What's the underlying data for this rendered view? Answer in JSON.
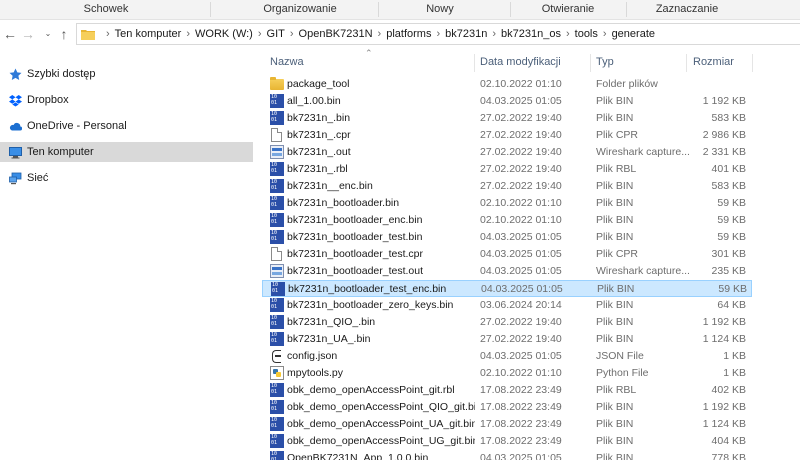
{
  "ribbon": {
    "groups": [
      "Schowek",
      "Organizowanie",
      "Nowy",
      "Otwieranie",
      "Zaznaczanie"
    ]
  },
  "nav": {
    "back_icon": "arrow-left-icon",
    "forward_icon": "arrow-right-icon",
    "dropdown_icon": "chevron-down-icon",
    "up_icon": "arrow-up-icon"
  },
  "address": {
    "crumbs": [
      "Ten komputer",
      "WORK (W:)",
      "GIT",
      "OpenBK7231N",
      "platforms",
      "bk7231n",
      "bk7231n_os",
      "tools",
      "generate"
    ]
  },
  "sidebar": {
    "items": [
      {
        "label": "Szybki dostęp",
        "icon": "star-icon"
      },
      {
        "label": "Dropbox",
        "icon": "dropbox-icon"
      },
      {
        "label": "OneDrive - Personal",
        "icon": "cloud-icon"
      },
      {
        "label": "Ten komputer",
        "icon": "computer-icon",
        "selected": true
      },
      {
        "label": "Sieć",
        "icon": "network-icon"
      }
    ]
  },
  "columns": {
    "name": "Nazwa",
    "date": "Data modyfikacji",
    "type": "Typ",
    "size": "Rozmiar"
  },
  "files": [
    {
      "name": "package_tool",
      "date": "02.10.2022 01:10",
      "type": "Folder plików",
      "size": "",
      "icon": "folder"
    },
    {
      "name": "all_1.00.bin",
      "date": "04.03.2025 01:05",
      "type": "Plik BIN",
      "size": "1 192 KB",
      "icon": "bin"
    },
    {
      "name": "bk7231n_.bin",
      "date": "27.02.2022 19:40",
      "type": "Plik BIN",
      "size": "583 KB",
      "icon": "bin"
    },
    {
      "name": "bk7231n_.cpr",
      "date": "27.02.2022 19:40",
      "type": "Plik CPR",
      "size": "2 986 KB",
      "icon": "doc"
    },
    {
      "name": "bk7231n_.out",
      "date": "27.02.2022 19:40",
      "type": "Wireshark capture...",
      "size": "2 331 KB",
      "icon": "ws"
    },
    {
      "name": "bk7231n_.rbl",
      "date": "27.02.2022 19:40",
      "type": "Plik RBL",
      "size": "401 KB",
      "icon": "bin"
    },
    {
      "name": "bk7231n__enc.bin",
      "date": "27.02.2022 19:40",
      "type": "Plik BIN",
      "size": "583 KB",
      "icon": "bin"
    },
    {
      "name": "bk7231n_bootloader.bin",
      "date": "02.10.2022 01:10",
      "type": "Plik BIN",
      "size": "59 KB",
      "icon": "bin"
    },
    {
      "name": "bk7231n_bootloader_enc.bin",
      "date": "02.10.2022 01:10",
      "type": "Plik BIN",
      "size": "59 KB",
      "icon": "bin"
    },
    {
      "name": "bk7231n_bootloader_test.bin",
      "date": "04.03.2025 01:05",
      "type": "Plik BIN",
      "size": "59 KB",
      "icon": "bin"
    },
    {
      "name": "bk7231n_bootloader_test.cpr",
      "date": "04.03.2025 01:05",
      "type": "Plik CPR",
      "size": "301 KB",
      "icon": "doc"
    },
    {
      "name": "bk7231n_bootloader_test.out",
      "date": "04.03.2025 01:05",
      "type": "Wireshark capture...",
      "size": "235 KB",
      "icon": "ws"
    },
    {
      "name": "bk7231n_bootloader_test_enc.bin",
      "date": "04.03.2025 01:05",
      "type": "Plik BIN",
      "size": "59 KB",
      "icon": "bin",
      "selected": true
    },
    {
      "name": "bk7231n_bootloader_zero_keys.bin",
      "date": "03.06.2024 20:14",
      "type": "Plik BIN",
      "size": "64 KB",
      "icon": "bin"
    },
    {
      "name": "bk7231n_QIO_.bin",
      "date": "27.02.2022 19:40",
      "type": "Plik BIN",
      "size": "1 192 KB",
      "icon": "bin"
    },
    {
      "name": "bk7231n_UA_.bin",
      "date": "27.02.2022 19:40",
      "type": "Plik BIN",
      "size": "1 124 KB",
      "icon": "bin"
    },
    {
      "name": "config.json",
      "date": "04.03.2025 01:05",
      "type": "JSON File",
      "size": "1 KB",
      "icon": "json"
    },
    {
      "name": "mpytools.py",
      "date": "02.10.2022 01:10",
      "type": "Python File",
      "size": "1 KB",
      "icon": "py"
    },
    {
      "name": "obk_demo_openAccessPoint_git.rbl",
      "date": "17.08.2022 23:49",
      "type": "Plik RBL",
      "size": "402 KB",
      "icon": "bin"
    },
    {
      "name": "obk_demo_openAccessPoint_QIO_git.bin",
      "date": "17.08.2022 23:49",
      "type": "Plik BIN",
      "size": "1 192 KB",
      "icon": "bin"
    },
    {
      "name": "obk_demo_openAccessPoint_UA_git.bin",
      "date": "17.08.2022 23:49",
      "type": "Plik BIN",
      "size": "1 124 KB",
      "icon": "bin"
    },
    {
      "name": "obk_demo_openAccessPoint_UG_git.bin",
      "date": "17.08.2022 23:49",
      "type": "Plik BIN",
      "size": "404 KB",
      "icon": "bin"
    },
    {
      "name": "OpenBK7231N_App_1.0.0.bin",
      "date": "04.03.2025 01:05",
      "type": "Plik BIN",
      "size": "778 KB",
      "icon": "bin"
    }
  ]
}
